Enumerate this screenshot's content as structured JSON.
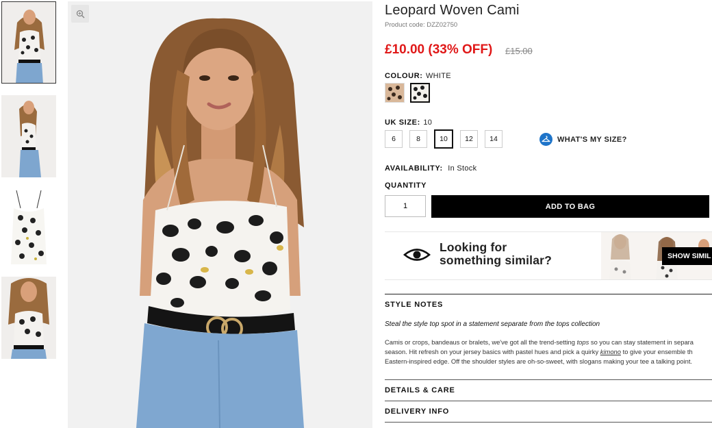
{
  "product": {
    "title": "Leopard Woven Cami",
    "code": "Product code: DZZ02750",
    "price": "£10.00 (33% OFF)",
    "old_price": "£15.00"
  },
  "colour": {
    "label": "COLOUR:",
    "value": "WHITE"
  },
  "size": {
    "label": "UK SIZE:",
    "value": "10",
    "options": [
      "6",
      "8",
      "10",
      "12",
      "14"
    ],
    "selected": "10",
    "whats_my_size": "WHAT'S MY SIZE?"
  },
  "availability": {
    "label": "AVAILABILITY:",
    "value": "In Stock"
  },
  "quantity": {
    "label": "QUANTITY",
    "value": "1"
  },
  "add_to_bag": "ADD TO BAG",
  "similar": {
    "line1": "Looking for",
    "line2": "something similar?",
    "button": "SHOW SIMIL"
  },
  "style_notes": {
    "title": "STYLE NOTES",
    "strap": "Steal the style top spot in a statement separate from the tops collection",
    "line1_a": "Camis or crops, bandeaus or bralets, we've got all the trend-setting ",
    "line1_em": "tops",
    "line1_b": " so you can stay statement in separa",
    "line2_a": "season. Hit refresh on your jersey basics with pastel hues and pick a quirky ",
    "line2_u": "kimono",
    "line2_b": " to give your ensemble th",
    "line3": "Eastern-inspired edge. Off the shoulder styles are oh-so-sweet, with slogans making your tee a talking point."
  },
  "details_care": "DETAILS & CARE",
  "delivery_info": "DELIVERY INFO",
  "icons": {
    "zoom": "zoom-in-icon",
    "hanger": "hanger-icon",
    "eye": "eye-icon"
  },
  "colors": {
    "price_red": "#e01818",
    "button_black": "#000000",
    "size_blue": "#1e74c9"
  }
}
